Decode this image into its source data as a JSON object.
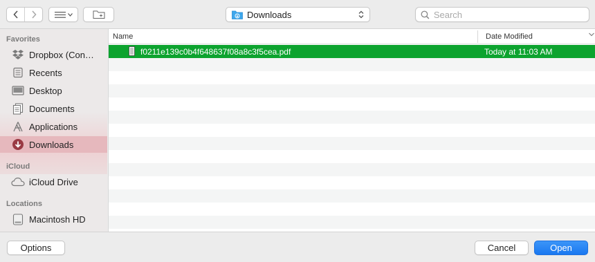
{
  "toolbar": {
    "location": "Downloads",
    "search_placeholder": "Search"
  },
  "sidebar": {
    "favorites_header": "Favorites",
    "favorites": [
      {
        "label": "Dropbox (Con…",
        "icon": "dropbox-icon"
      },
      {
        "label": "Recents",
        "icon": "recents-icon"
      },
      {
        "label": "Desktop",
        "icon": "desktop-icon"
      },
      {
        "label": "Documents",
        "icon": "documents-icon"
      },
      {
        "label": "Applications",
        "icon": "applications-icon"
      },
      {
        "label": "Downloads",
        "icon": "downloads-icon",
        "selected": true
      }
    ],
    "icloud_header": "iCloud",
    "icloud": [
      {
        "label": "iCloud Drive",
        "icon": "cloud-icon"
      }
    ],
    "locations_header": "Locations",
    "locations": [
      {
        "label": "Macintosh HD",
        "icon": "harddrive-icon"
      }
    ]
  },
  "filelist": {
    "columns": {
      "name": "Name",
      "date_modified": "Date Modified"
    },
    "files": [
      {
        "name": "f0211e139c0b4f648637f08a8c3f5cea.pdf",
        "date": "Today at 11:03 AM",
        "selected": true
      }
    ]
  },
  "buttons": {
    "options": "Options",
    "cancel": "Cancel",
    "open": "Open"
  },
  "colors": {
    "selection_row": "#0da32f",
    "sidebar_selection": "#e6b8bd",
    "accent_button": "#1a78f0"
  }
}
